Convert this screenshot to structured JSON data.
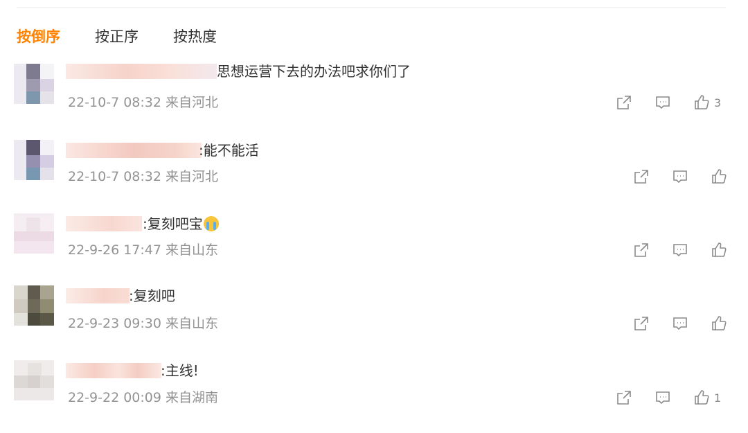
{
  "sort": {
    "tabs": [
      {
        "label": "按倒序",
        "active": true
      },
      {
        "label": "按正序",
        "active": false
      },
      {
        "label": "按热度",
        "active": false
      }
    ]
  },
  "comments": [
    {
      "text": "思想运营下去的办法吧求你们了",
      "time": "22-10-7 08:32",
      "location": "来自河北",
      "likes": "3"
    },
    {
      "text": ":能不能活",
      "time": "22-10-7 08:32",
      "location": "来自河北",
      "likes": ""
    },
    {
      "text": ":复刻吧宝",
      "time": "22-9-26 17:47",
      "location": "来自山东",
      "likes": "",
      "emoji": "crying-emoji"
    },
    {
      "text": ":复刻吧",
      "time": "22-9-23 09:30",
      "location": "来自山东",
      "likes": ""
    },
    {
      "text": ":主线!",
      "time": "22-9-22 00:09",
      "location": "来自湖南",
      "likes": "1"
    }
  ],
  "icons": {
    "share": "share-icon",
    "reply": "comment-icon",
    "like": "thumbs-up-icon"
  },
  "colors": {
    "active_tab": "#ff8200",
    "meta_text": "#939393",
    "icon": "#8a8a8a"
  }
}
